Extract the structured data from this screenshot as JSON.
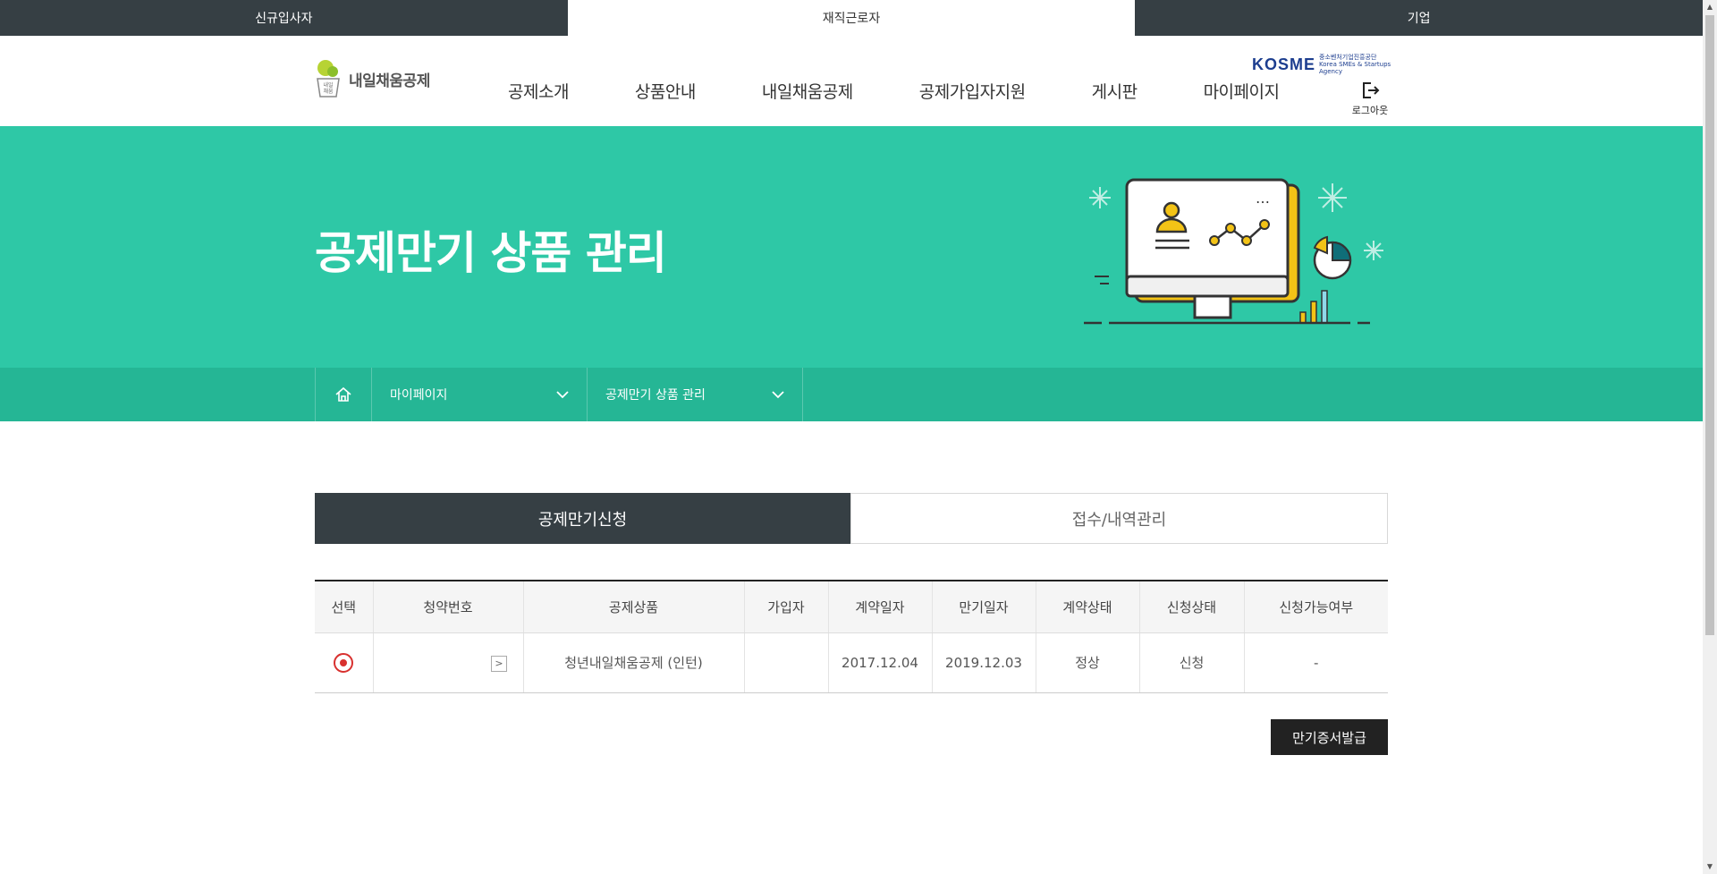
{
  "user_types": [
    {
      "label": "신규입사자",
      "active": false
    },
    {
      "label": "재직근로자",
      "active": true
    },
    {
      "label": "기업",
      "active": false
    }
  ],
  "header": {
    "logo_text": "내일채움공제",
    "logo_badge": "내일 채움",
    "nav": [
      "공제소개",
      "상품안내",
      "내일채움공제",
      "공제가입자지원",
      "게시판",
      "마이페이지"
    ],
    "kosme_mark": "KOSME",
    "kosme_sub": "중소벤처기업진흥공단 Korea SMEs & Startups Agency",
    "logout_label": "로그아웃"
  },
  "banner": {
    "title": "공제만기 상품 관리"
  },
  "breadcrumb": {
    "level1": "마이페이지",
    "level2": "공제만기 상품 관리"
  },
  "tabs": [
    {
      "label": "공제만기신청",
      "active": true
    },
    {
      "label": "접수/내역관리",
      "active": false
    }
  ],
  "table": {
    "columns": [
      "선택",
      "청약번호",
      "공제상품",
      "가입자",
      "계약일자",
      "만기일자",
      "계약상태",
      "신청상태",
      "신청가능여부"
    ],
    "rows": [
      {
        "selected": true,
        "subscription_no": "",
        "product": "청년내일채움공제 (인턴)",
        "subscriber": "",
        "contract_date": "2017.12.04",
        "maturity_date": "2019.12.03",
        "contract_status": "정상",
        "application_status": "신청",
        "eligible": "-"
      }
    ]
  },
  "actions": {
    "issue_certificate": "만기증서발급"
  },
  "colors": {
    "dark": "#363f44",
    "banner": "#2ec8a6",
    "breadcrumb": "#25b695",
    "radio": "#d8312f"
  }
}
